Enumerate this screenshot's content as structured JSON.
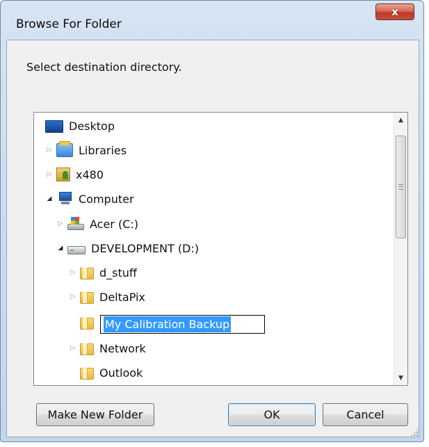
{
  "window": {
    "title": "Browse For Folder",
    "close_label": "x"
  },
  "instruction": "Select destination directory.",
  "tree": {
    "items": [
      {
        "label": "Desktop",
        "icon": "desktop-icon",
        "expander": "none"
      },
      {
        "label": "Libraries",
        "icon": "libraries-icon",
        "expander": "collapsed"
      },
      {
        "label": "x480",
        "icon": "user-folder-icon",
        "expander": "collapsed"
      },
      {
        "label": "Computer",
        "icon": "computer-icon",
        "expander": "expanded"
      },
      {
        "label": "Acer (C:)",
        "icon": "drive-icon",
        "expander": "collapsed"
      },
      {
        "label": "DEVELOPMENT (D:)",
        "icon": "hard-drive-icon",
        "expander": "expanded"
      },
      {
        "label": "d_stuff",
        "icon": "folder-icon",
        "expander": "collapsed"
      },
      {
        "label": "DeltaPix",
        "icon": "folder-icon",
        "expander": "collapsed"
      },
      {
        "label": "My Calibration Backup",
        "icon": "folder-icon",
        "expander": "none",
        "state": "renaming"
      },
      {
        "label": "Network",
        "icon": "folder-icon",
        "expander": "collapsed"
      },
      {
        "label": "Outlook",
        "icon": "folder-icon",
        "expander": "none"
      }
    ]
  },
  "buttons": {
    "make_new_folder": "Make New Folder",
    "ok": "OK",
    "cancel": "Cancel"
  },
  "glyphs": {
    "collapsed": "▷",
    "expanded": "◢",
    "scroll_up": "▲",
    "scroll_down": "▼"
  },
  "colors": {
    "selection": "#3399ff",
    "close_button": "#c0392b"
  }
}
